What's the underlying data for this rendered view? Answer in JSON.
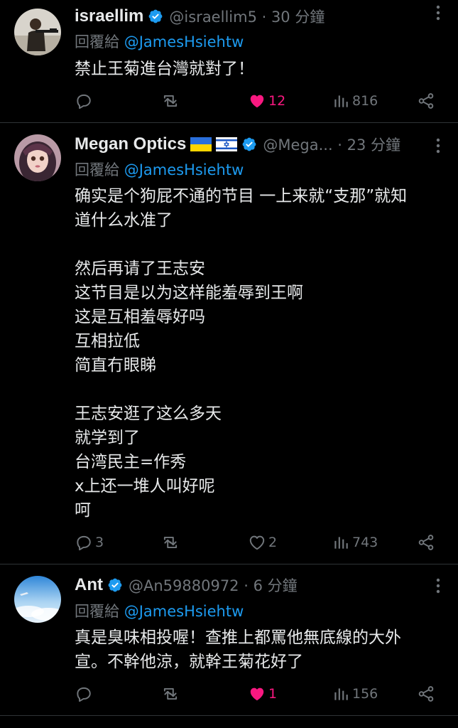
{
  "tweets": [
    {
      "name": "israellim",
      "handle": "@israellim5 · 30 分鐘",
      "reply_prefix": "回覆給",
      "reply_to": "@JamesHsiehtw",
      "lines": [
        "禁止王菊進台灣就對了！"
      ],
      "replies": "",
      "retweets": "",
      "likes": "12",
      "liked": true,
      "views": "816"
    },
    {
      "name": "Megan Optics",
      "handle": "@Mega... · 23 分鐘",
      "reply_prefix": "回覆給",
      "reply_to": "@JamesHsiehtw",
      "lines": [
        "确实是个狗屁不通的节目 一上来就“支那”就知",
        "道什么水准了",
        "",
        "然后再请了王志安",
        "这节目是以为这样能羞辱到王啊",
        "这是互相羞辱好吗",
        "互相拉低",
        "简直冇眼睇",
        "",
        "王志安逛了这么多天",
        "就学到了",
        "台湾民主=作秀",
        "x上还一堆人叫好呢",
        "呵"
      ],
      "replies": "3",
      "retweets": "",
      "likes": "2",
      "liked": false,
      "views": "743"
    },
    {
      "name": "Ant",
      "handle": "@An59880972 · 6 分鐘",
      "reply_prefix": "回覆給",
      "reply_to": "@JamesHsiehtw",
      "lines": [
        "真是臭味相投喔！查推上都罵他無底線的大外",
        "宣。不幹他涼，就幹王菊花好了"
      ],
      "replies": "",
      "retweets": "",
      "likes": "1",
      "liked": true,
      "views": "156"
    }
  ],
  "icons": {
    "verified": "verified-badge-icon",
    "reply": "reply-icon",
    "retweet": "retweet-icon",
    "like": "heart-icon",
    "views": "views-bar-chart-icon",
    "share": "share-icon",
    "more": "more-dots-icon",
    "flags": [
      "ukraine-flag-icon",
      "israel-flag-icon"
    ]
  },
  "colors": {
    "background": "#000000",
    "text": "#e7e9ea",
    "secondary": "#71767b",
    "link": "#1d9bf0",
    "like": "#f91880",
    "divider": "#2f3336"
  }
}
